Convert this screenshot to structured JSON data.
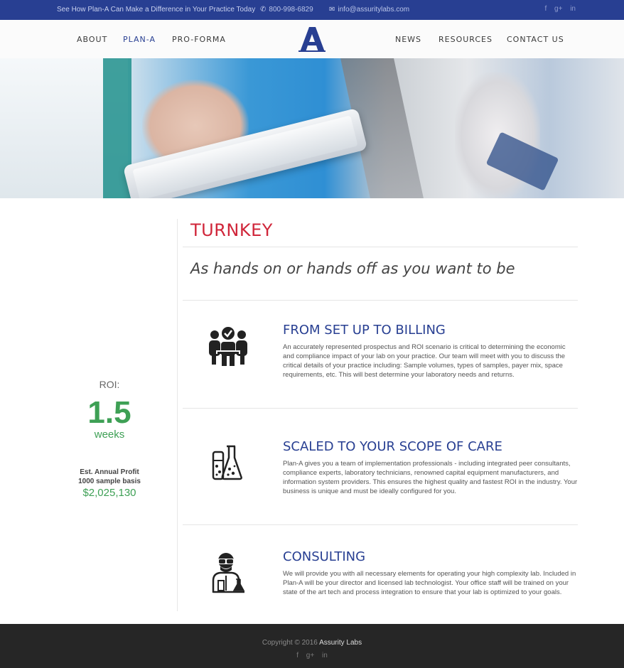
{
  "topbar": {
    "tagline": "See How Plan-A Can Make a Difference in Your Practice Today",
    "phone_icon": "phone-icon",
    "phone": "800-998-6829",
    "email_icon": "envelope-icon",
    "email": "info@assuritylabs.com",
    "social": [
      "f",
      "g+",
      "in"
    ]
  },
  "nav": {
    "left": [
      "ABOUT",
      "PLAN-A",
      "PRO-FORMA"
    ],
    "right": [
      "NEWS",
      "RESOURCES",
      "CONTACT US"
    ],
    "active": "PLAN-A",
    "logo_icon": "letter-a-logo"
  },
  "roi": {
    "label": "ROI:",
    "value": "1.5",
    "unit": "weeks",
    "profit_label_1": "Est. Annual Profit",
    "profit_label_2": "1000 sample basis",
    "profit_value": "$2,025,130"
  },
  "main": {
    "title": "TURNKEY",
    "subtitle": "As hands on or hands off as you want to be",
    "features": [
      {
        "icon": "team-icon",
        "title": "FROM SET UP TO BILLING",
        "text": "An accurately represented prospectus and ROI scenario is critical to determining the economic and compliance impact of your lab on your practice. Our team will meet with you to discuss the critical details of your practice including: Sample volumes, types of samples, payer mix, space requirements, etc. This will best determine your laboratory needs and returns."
      },
      {
        "icon": "lab-flask-icon",
        "title": "SCALED TO YOUR SCOPE OF CARE",
        "text": "Plan-A gives you a team of implementation professionals - including integrated peer consultants, compliance experts, laboratory technicians, renowned capital equipment manufacturers, and information system providers. This ensures the highest quality and fastest ROI in the industry. Your business is unique and must be ideally configured for you."
      },
      {
        "icon": "scientist-icon",
        "title": "CONSULTING",
        "text": "We will provide you with all necessary elements for operating your high complexity lab. Included in Plan-A will be your director and licensed lab technologist. Your office staff will be trained on your state of the art tech and process integration to ensure that your lab is optimized to your goals."
      }
    ]
  },
  "footer": {
    "copyright": "Copyright © 2016",
    "brand": "Assurity Labs",
    "social": [
      "f",
      "g+",
      "in"
    ]
  },
  "colors": {
    "brand_blue": "#283f92",
    "accent_red": "#d0263a",
    "roi_green": "#3ea055",
    "footer_bg": "#262626"
  }
}
